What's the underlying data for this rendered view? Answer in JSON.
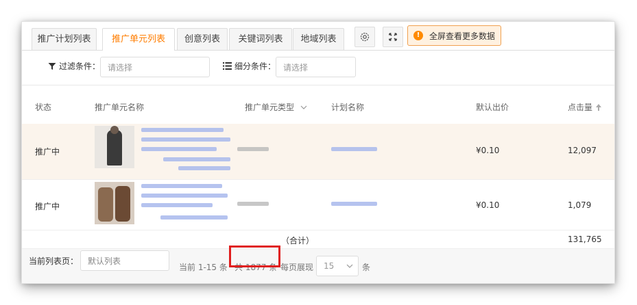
{
  "tabs": [
    "推广计划列表",
    "推广单元列表",
    "创意列表",
    "关键词列表",
    "地域列表"
  ],
  "toolbar": {
    "fullscreen_label": "全屏查看更多数据",
    "settings_icon": "gear-icon",
    "expand_icon": "expand-icon"
  },
  "filters": {
    "filter_label": "过滤条件：",
    "filter_placeholder": "请选择",
    "segment_label": "细分条件：",
    "segment_placeholder": "请选择"
  },
  "table": {
    "headers": [
      "状态",
      "推广单元名称",
      "推广单元类型",
      "计划名称",
      "默认出价",
      "点击量"
    ],
    "rows": [
      {
        "status": "推广中",
        "bid": "¥0.10",
        "clicks": "12,097"
      },
      {
        "status": "推广中",
        "bid": "¥0.10",
        "clicks": "1,079"
      }
    ],
    "total_label": "（合计）",
    "total_clicks": "131,765"
  },
  "footer": {
    "current_list_label": "当前列表页：",
    "current_list_value": "默认列表",
    "range_text": "当前 1-15 条",
    "total_text": "共 1877 条",
    "per_page_label": "每页展现",
    "per_page_value": "15",
    "per_page_unit": "条"
  },
  "colors": {
    "accent": "#ff7d00",
    "highlight_row": "#fbf4ec",
    "highlight_box": "#e01e1e"
  }
}
